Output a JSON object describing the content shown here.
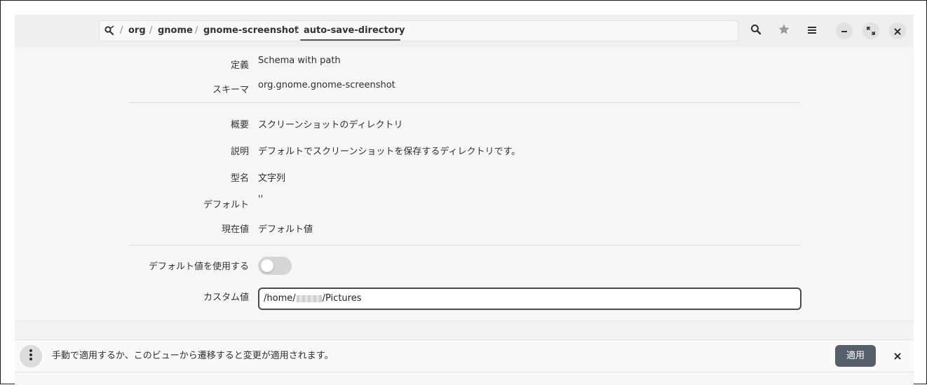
{
  "breadcrumb": {
    "root_icon": "dconf-root-icon",
    "items": [
      "org",
      "gnome",
      "gnome-screenshot",
      "auto-save-directory"
    ],
    "separator": "/"
  },
  "header": {
    "search_icon": "search-icon",
    "bookmark_icon": "star-icon",
    "menu_icon": "hamburger-menu-icon",
    "minimize_icon": "minimize-icon",
    "maximize_icon": "maximize-icon",
    "close_icon": "close-icon"
  },
  "properties": {
    "definition_label": "定義",
    "definition_value": "Schema with path",
    "schema_label": "スキーマ",
    "schema_value": "org.gnome.gnome-screenshot",
    "summary_label": "概要",
    "summary_value": "スクリーンショットのディレクトリ",
    "description_label": "説明",
    "description_value": "デフォルトでスクリーンショットを保存するディレクトリです。",
    "type_label": "型名",
    "type_value": "文字列",
    "default_label": "デフォルト",
    "default_value": "''",
    "current_label": "現在値",
    "current_value": "デフォルト値"
  },
  "editor": {
    "use_default_label": "デフォルト値を使用する",
    "use_default_on": false,
    "custom_label": "カスタム値",
    "custom_value_prefix": "/home/",
    "custom_value_suffix": "/Pictures"
  },
  "infobar": {
    "message": "手動で適用するか、このビューから遷移すると変更が適用されます。",
    "apply_label": "適用",
    "options_icon": "vertical-dots-icon",
    "dismiss_icon": "close-icon"
  },
  "colors": {
    "apply_button_bg": "#56606b",
    "window_bg": "#f6f6f6"
  }
}
